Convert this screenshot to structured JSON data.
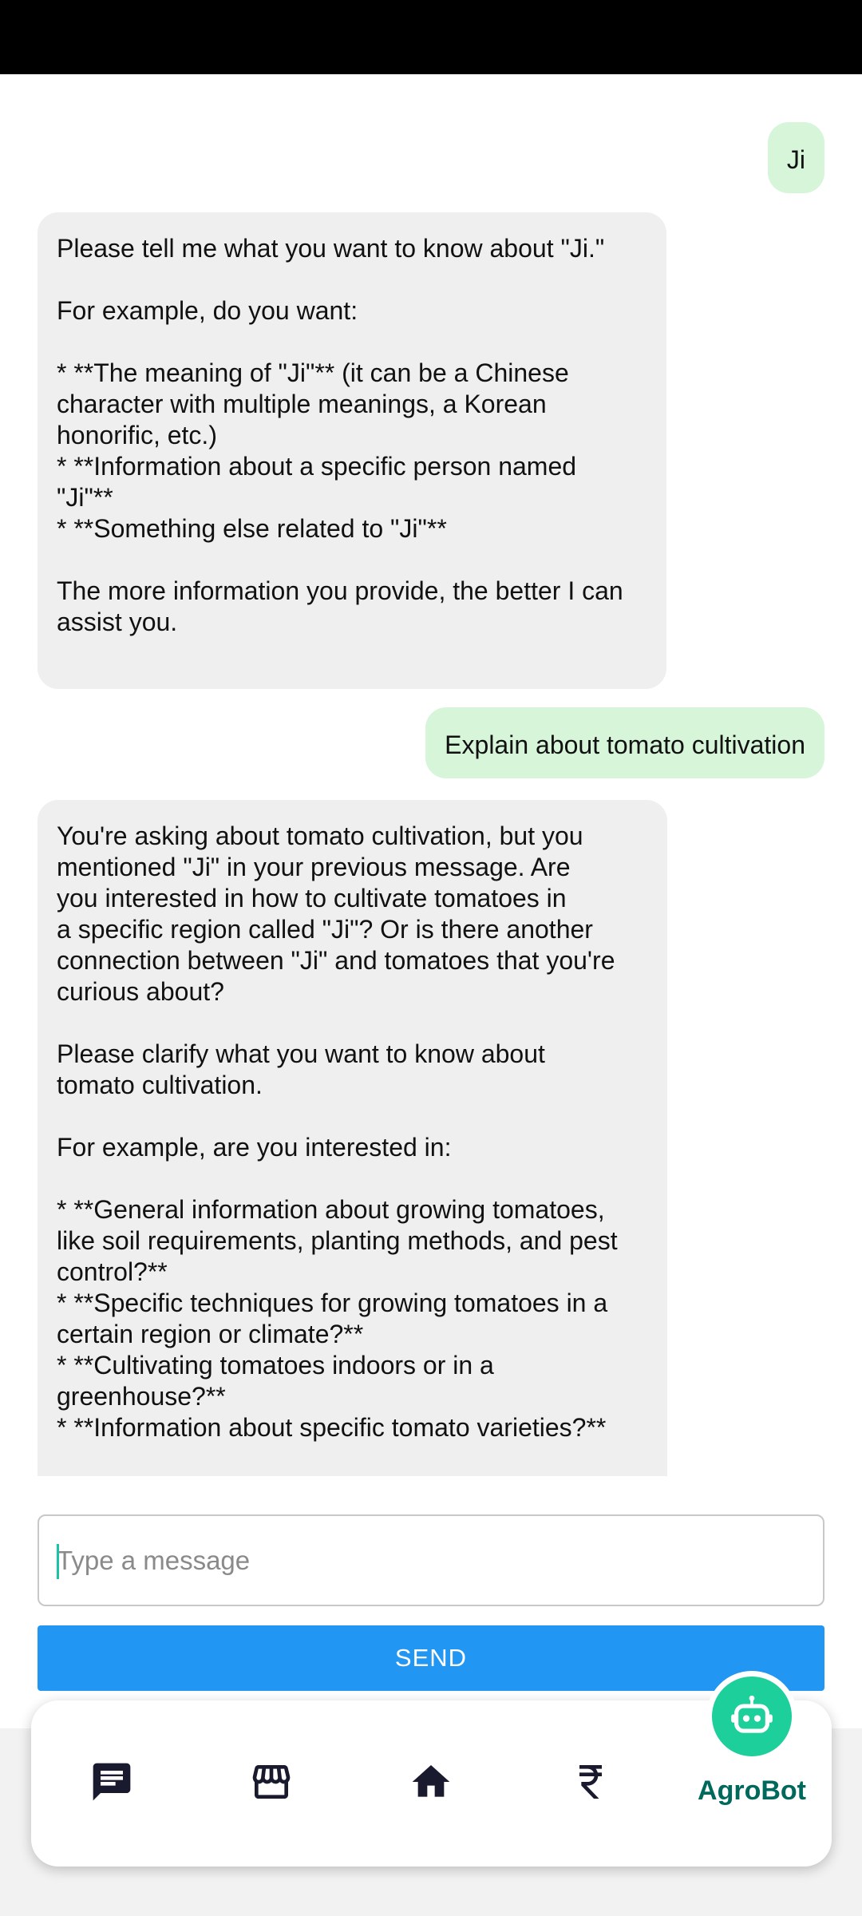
{
  "messages": [
    {
      "role": "user",
      "text": "Ji"
    },
    {
      "role": "bot",
      "text": "Please tell me what you want to know about \"Ji.\"\n\nFor example, do you want:\n\n* **The meaning of \"Ji\"** (it can be a Chinese\ncharacter with multiple meanings, a Korean\nhonorific, etc.)\n* **Information about a specific person named\n\"Ji\"**\n* **Something else related to \"Ji\"**\n\nThe more information you provide, the better I can\nassist you.\n"
    },
    {
      "role": "user",
      "text": "Explain about tomato cultivation"
    },
    {
      "role": "bot",
      "text": "You're asking about tomato cultivation, but you\nmentioned \"Ji\" in your previous message. Are\nyou interested in how to cultivate tomatoes in\na specific region called \"Ji\"? Or is there another\nconnection between \"Ji\" and tomatoes that you're\ncurious about?\n\nPlease clarify what you want to know about\ntomato cultivation.\n\nFor example, are you interested in:\n\n* **General information about growing tomatoes,\nlike soil requirements, planting methods, and pest\ncontrol?**\n* **Specific techniques for growing tomatoes in a\ncertain region or climate?**\n* **Cultivating tomatoes indoors or in a\ngreenhouse?**\n* **Information about specific tomato varieties?**"
    }
  ],
  "composer": {
    "placeholder": "Type a message",
    "value": "",
    "send_label": "SEND"
  },
  "nav": {
    "items": [
      {
        "icon": "chat-icon"
      },
      {
        "icon": "store-icon"
      },
      {
        "icon": "home-icon"
      },
      {
        "icon": "rupee-icon"
      }
    ],
    "agrobot_label": "AgroBot",
    "agrobot_icon": "robot-icon"
  },
  "colors": {
    "user_bubble": "#d6f5d9",
    "bot_bubble": "#efefef",
    "send_button": "#2196f3",
    "agrobot_accent": "#1ccf9b",
    "agrobot_label": "#00695c"
  }
}
